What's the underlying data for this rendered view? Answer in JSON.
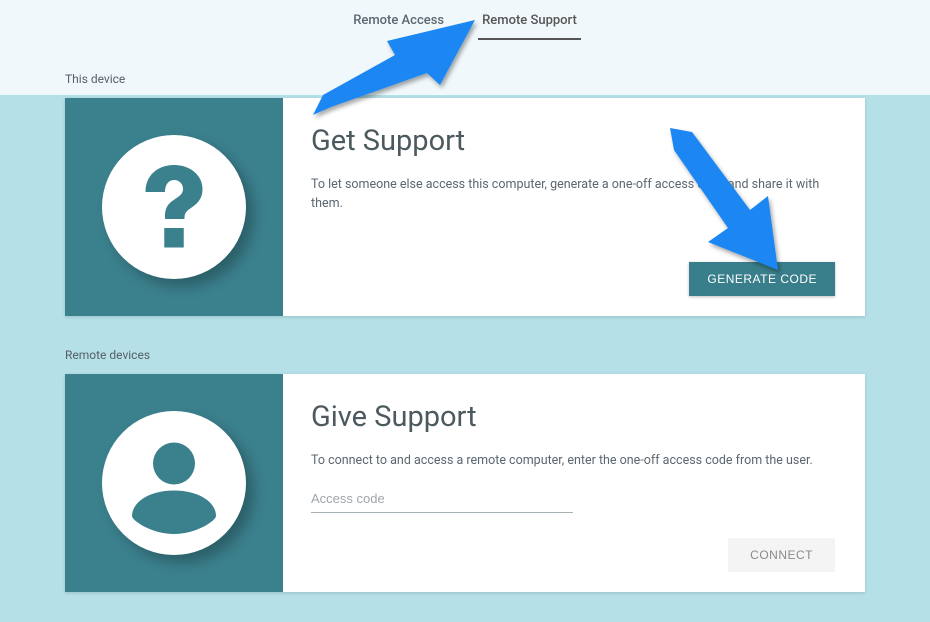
{
  "tabs": {
    "access": "Remote Access",
    "support": "Remote Support"
  },
  "sections": {
    "this_device_label": "This device",
    "remote_devices_label": "Remote devices"
  },
  "get_support": {
    "title": "Get Support",
    "desc": "To let someone else access this computer, generate a one-off access code and share it with them.",
    "button": "GENERATE CODE"
  },
  "give_support": {
    "title": "Give Support",
    "desc": "To connect to and access a remote computer, enter the one-off access code from the user.",
    "placeholder": "Access code",
    "button": "CONNECT"
  },
  "colors": {
    "teal": "#3b808d",
    "arrow": "#1b87f3"
  }
}
